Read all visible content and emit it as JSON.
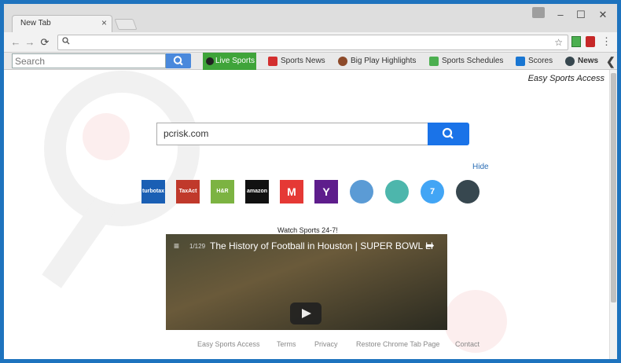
{
  "tab": {
    "title": "New Tab",
    "close": "×"
  },
  "window": {
    "minimize": "–",
    "maximize": "☐",
    "close": "✕"
  },
  "toolbar": {
    "back": "←",
    "forward": "→",
    "reload": "⟳",
    "search_icon": "🔍",
    "star": "☆",
    "menu": "⋮"
  },
  "extbar": {
    "search_placeholder": "Search",
    "live": "Live Sports",
    "links": [
      "Sports News",
      "Big Play Highlights",
      "Sports Schedules",
      "Scores",
      "News"
    ],
    "chevron": "❮"
  },
  "page": {
    "brand": "Easy Sports Access",
    "search_value": "pcrisk.com",
    "hide": "Hide",
    "shortcuts": [
      "turbotax",
      "TaxAct",
      "H&R BLOCK",
      "amazon",
      "M",
      "Y",
      "",
      "",
      "7",
      ""
    ],
    "watch": "Watch Sports 24-7!",
    "video": {
      "count": "1/129",
      "title": "The History of Football in Houston | SUPER BOWL LI"
    },
    "footer": [
      "Easy Sports Access",
      "Terms",
      "Privacy",
      "Restore Chrome Tab Page",
      "Contact"
    ]
  },
  "colors": {
    "accent": "#1a73e8",
    "live": "#3fa43a",
    "border": "#1e73be"
  }
}
